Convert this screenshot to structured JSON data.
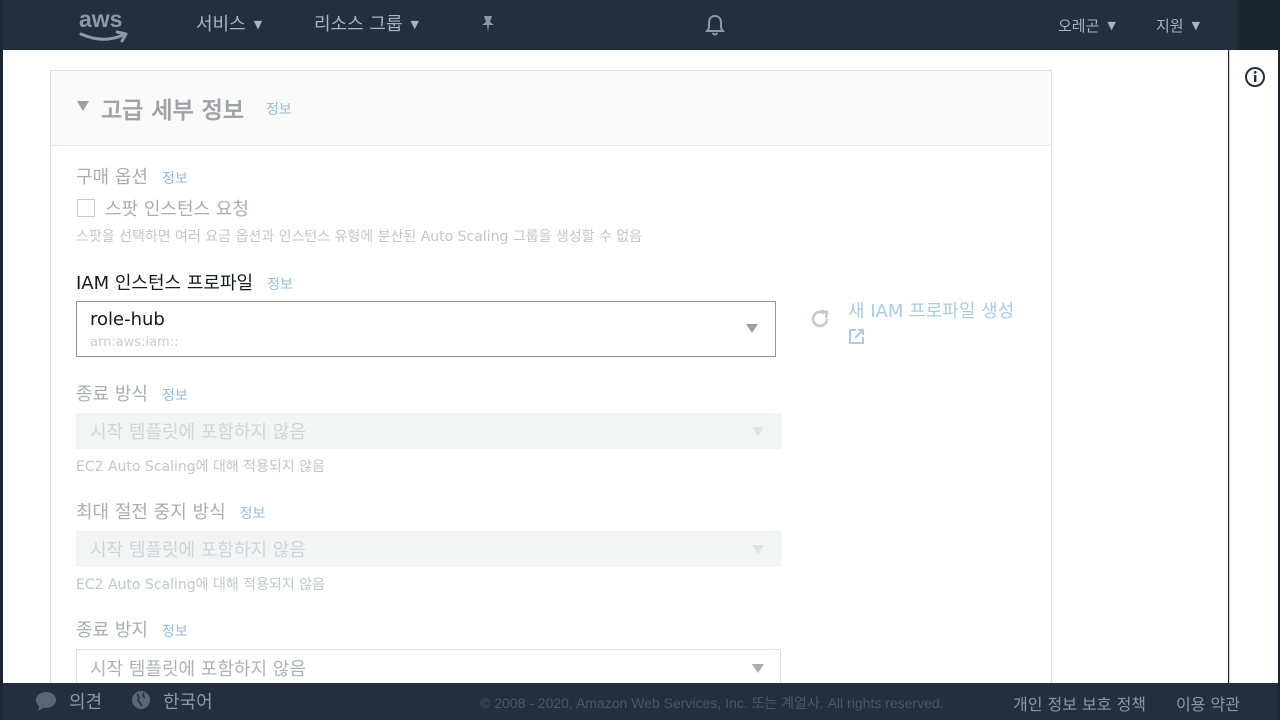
{
  "topnav": {
    "logo": "aws",
    "services": "서비스",
    "resource_groups": "리소스 그룹",
    "region": "오레곤",
    "support": "지원"
  },
  "panel": {
    "title": "고급 세부 정보",
    "info": "정보",
    "purchase_option": {
      "label": "구매 옵션",
      "info": "정보",
      "checkbox_label": "스팟 인스턴스 요청",
      "checked": false,
      "hint": "스팟을 선택하면 여러 요금 옵션과 인스턴스 유형에 분산된 Auto Scaling 그룹을 생성할 수 없음"
    },
    "iam_profile": {
      "label": "IAM 인스턴스 프로파일",
      "info": "정보",
      "value": "role-hub",
      "arn": "arn:aws:iam::",
      "new_link": "새 IAM 프로파일 생성"
    },
    "shutdown_behavior": {
      "label": "종료 방식",
      "info": "정보",
      "value": "시작 템플릿에 포함하지 않음",
      "hint": "EC2 Auto Scaling에 대해 적용되지 않음"
    },
    "stop_hibernate": {
      "label": "최대 절전 중지 방식",
      "info": "정보",
      "value": "시작 템플릿에 포함하지 않음",
      "hint": "EC2 Auto Scaling에 대해 적용되지 않음"
    },
    "termination_protection": {
      "label": "종료 방지",
      "info": "정보",
      "value": "시작 템플릿에 포함하지 않음"
    }
  },
  "footer": {
    "feedback": "의견",
    "language": "한국어",
    "copyright": "© 2008 - 2020, Amazon Web Services, Inc. 또는 계열사. All rights reserved.",
    "privacy": "개인 정보 보호 정책",
    "terms": "이용 약관"
  }
}
